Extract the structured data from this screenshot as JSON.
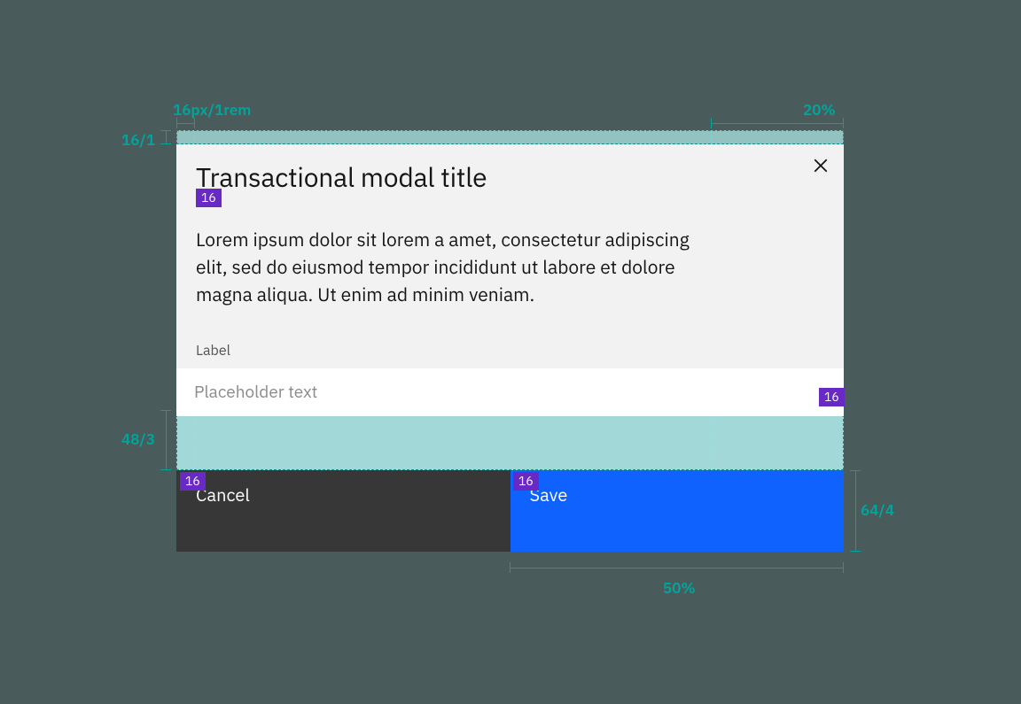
{
  "annotations": {
    "top_left_width": "16px/1rem",
    "top_right_width": "20%",
    "left_height_top": "16/1",
    "left_height_bottom": "48/3",
    "right_height_footer": "64/4",
    "bottom_percent": "50%"
  },
  "badges": {
    "under_title": "16",
    "input_right": "16",
    "footer_cancel_tl": "16",
    "footer_save_tl": "16"
  },
  "modal": {
    "title": "Transactional modal title",
    "body": "Lorem ipsum dolor sit lorem a amet, consectetur adipiscing elit, sed do eiusmod tempor incididunt ut labore et dolore magna aliqua. Ut enim ad minim veniam.",
    "label": "Label",
    "placeholder": "Placeholder text",
    "cancel": "Cancel",
    "save": "Save"
  }
}
